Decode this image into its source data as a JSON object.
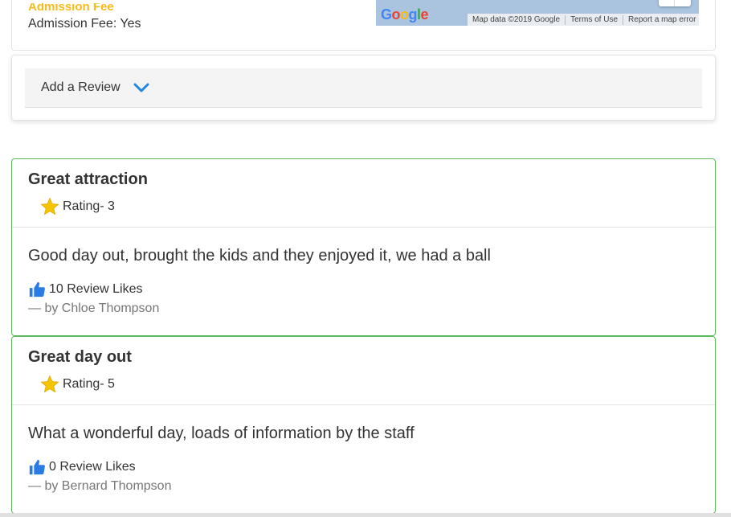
{
  "listing": {
    "admission_heading": "Admission Fee",
    "admission_value": "Admission Fee: Yes"
  },
  "map": {
    "logo": "Google",
    "attribution": "Map data ©2019 Google",
    "terms": "Terms of Use",
    "report": "Report a map error"
  },
  "add_review": {
    "label": "Add a Review",
    "icon": "chevron-down-icon"
  },
  "reviews": [
    {
      "title": "Great attraction",
      "rating_label": "Rating- 3",
      "rating": 3,
      "text": "Good day out, brought the kids and they enjoyed it, we had a ball",
      "likes_label": "10 Review Likes",
      "author": "— by Chloe Thompson"
    },
    {
      "title": "Great day out",
      "rating_label": "Rating- 5",
      "rating": 5,
      "text": "What a wonderful day, loads of information by the staff",
      "likes_label": "0 Review Likes",
      "author": "— by Bernard Thompson"
    }
  ],
  "colors": {
    "accent_green": "#5cb85c",
    "star_yellow": "#f5c400",
    "thumb_blue": "#2a7be4",
    "chevron_blue": "#1e88e5"
  }
}
